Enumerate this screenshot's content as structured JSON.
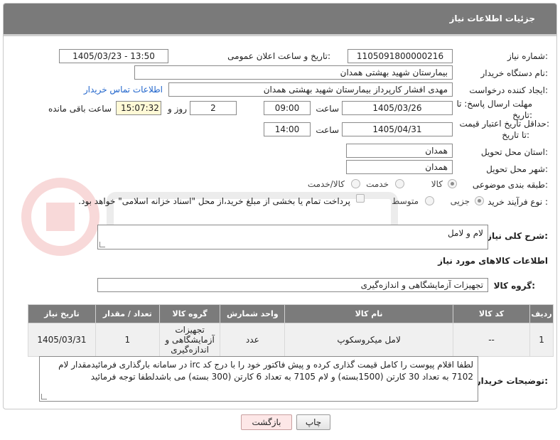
{
  "header": {
    "title": "جزئیات اطلاعات نیاز"
  },
  "fields": {
    "need_number_label": "شماره نیاز:",
    "need_number": "1105091800000216",
    "announce_label": "تاریخ و ساعت اعلان عمومی:",
    "announce_value": "1405/03/23 - 13:50",
    "buyer_org_label": "نام دستگاه خریدار:",
    "buyer_org": "بیمارستان شهید بهشتی همدان",
    "creator_label": "ایجاد کننده درخواست:",
    "creator": "مهدی افشار کارپرداز بیمارستان شهید بهشتی همدان",
    "contact_link": "اطلاعات تماس خریدار",
    "deadline_label_1": "مهلت ارسال پاسخ: تا",
    "deadline_label_2": "تاریخ:",
    "deadline_date": "1405/03/26",
    "time_label": "ساعت",
    "deadline_time": "09:00",
    "days_value": "2",
    "days_label": "روز و",
    "remaining_time": "15:07:32",
    "remaining_label": "ساعت باقی مانده",
    "validity_label_1": "حداقل تاریخ اعتبار قیمت:",
    "validity_label_2": "تا تاریخ:",
    "validity_date": "1405/04/31",
    "validity_time": "14:00",
    "province_label": "استان محل تحویل:",
    "province": "همدان",
    "city_label": "شهر محل تحویل:",
    "city": "همدان",
    "category_label": "طبقه بندی موضوعی:",
    "category_options": [
      "کالا",
      "خدمت",
      "کالا/خدمت"
    ],
    "process_label": "نوع فرآیند خرید :",
    "process_options": [
      "جزیی",
      "متوسط"
    ],
    "payment_note": "پرداخت تمام یا بخشی از مبلغ خرید،از محل \"اسناد خزانه اسلامی\" خواهد بود.",
    "description_label": "شرح کلی نیاز:",
    "description": "لام و لامل",
    "goods_info_label": "اطلاعات کالاهای مورد نیاز",
    "goods_group_label": "گروه کالا:",
    "goods_group": "تجهیزات آزمایشگاهی و اندازه‌گیری",
    "buyer_notes_label": "توضیحات خریدار:",
    "buyer_notes": "لطفا اقلام پیوست را کامل قیمت گذاری کرده و پیش فاکتور خود را با درج کد irc در سامانه بارگذاری فرمائیدمقدار  لام 7102 به تعداد 30 کارتن (1500بسته) و لام 7105 به تعداد 6 کارتن (300 بسته) می باشدلطفا توجه فرمائید"
  },
  "table": {
    "headers": [
      "ردیف",
      "کد کالا",
      "نام کالا",
      "واحد شمارش",
      "گروه کالا",
      "تعداد / مقدار",
      "تاریخ نیاز"
    ],
    "rows": [
      [
        "1",
        "--",
        "لامل میکروسکوپ",
        "عدد",
        "تجهیزات آزمایشگاهی و اندازه‌گیری",
        "1",
        "1405/03/31"
      ]
    ]
  },
  "buttons": {
    "print": "چاپ",
    "back": "بازگشت"
  },
  "colors": {
    "header_bg": "#7a7a7a",
    "accent_link": "#2266cc",
    "watermark": "#d33"
  },
  "icons": {
    "watermark": "ariatender-watermark-logo"
  }
}
